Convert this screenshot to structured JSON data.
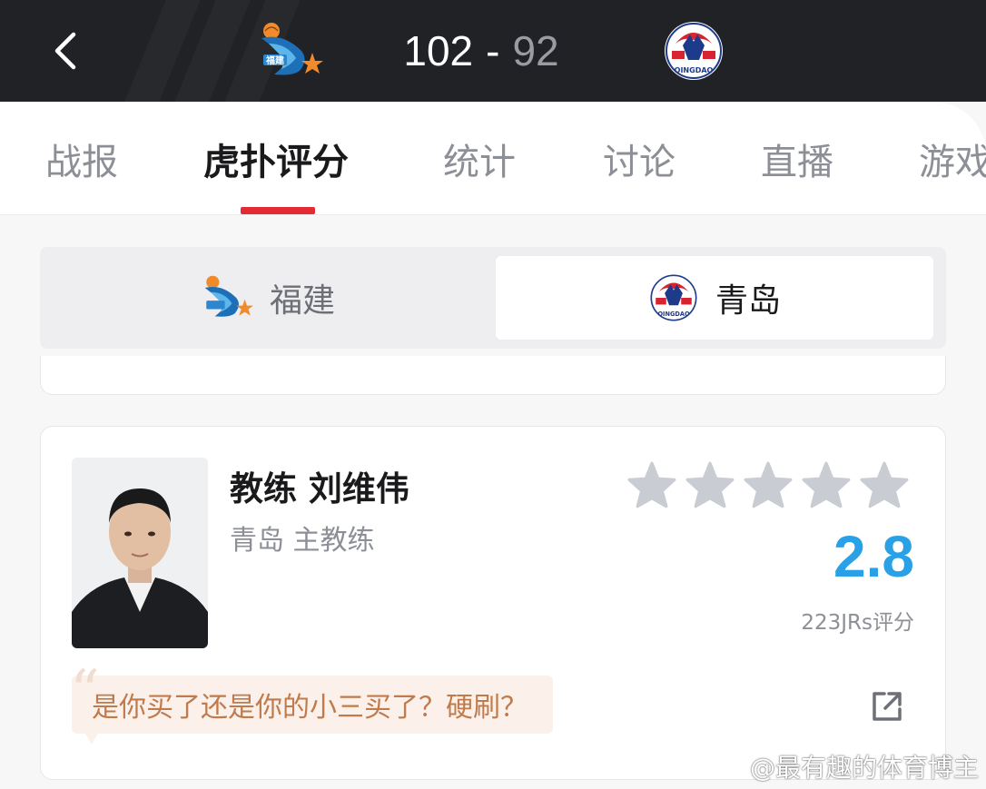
{
  "header": {
    "home_team_logo": "fujian-sturgeons-logo",
    "away_team_logo": "qingdao-eagles-logo",
    "home_score": "102",
    "separator": "-",
    "away_score": "92",
    "back_icon": "chevron-left-icon"
  },
  "tabs": [
    {
      "label": "战报",
      "active": false
    },
    {
      "label": "虎扑评分",
      "active": true
    },
    {
      "label": "统计",
      "active": false
    },
    {
      "label": "讨论",
      "active": false
    },
    {
      "label": "直播",
      "active": false
    },
    {
      "label": "游戏",
      "active": false
    }
  ],
  "team_switch": {
    "home": {
      "name": "福建",
      "selected": false
    },
    "away": {
      "name": "青岛",
      "selected": true
    }
  },
  "coach_card": {
    "name": "教练 刘维伟",
    "role": "青岛 主教练",
    "rating": "2.8",
    "rating_stars": 0,
    "rating_count": "223JRs评分",
    "top_comment": "是你买了还是你的小三买了？硬刷？",
    "share_icon": "share-external-icon"
  },
  "watermark": "@最有趣的体育博主",
  "colors": {
    "header_bg": "#212226",
    "accent_red": "#e32b35",
    "rating_blue": "#2aa0e6",
    "star_gray": "#c9ccd3",
    "comment_bg": "#fbf1ea",
    "comment_text": "#c07a4b"
  }
}
